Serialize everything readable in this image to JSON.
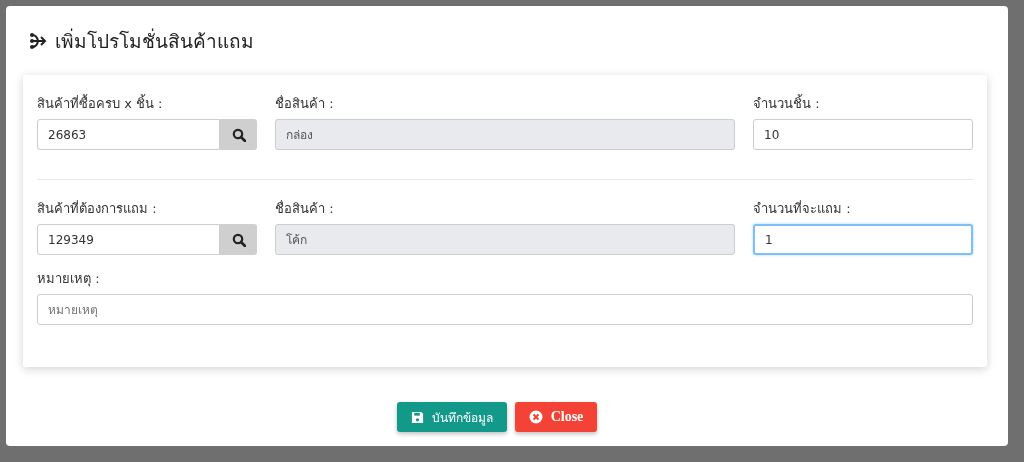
{
  "dialog": {
    "title": "เพิ่มโปรโมชั่นสินค้าแถม"
  },
  "sections": [
    {
      "fields": [
        {
          "kind": "lookup",
          "label": "สินค้าที่ซื้อครบ x ชิ้น :",
          "value": "26863",
          "focused": false
        },
        {
          "kind": "readonly",
          "label": "ชื่อสินค้า :",
          "value": "กล่อง",
          "focused": false
        },
        {
          "kind": "text",
          "label": "จำนวนชิ้น :",
          "value": "10",
          "focused": false
        }
      ]
    },
    {
      "fields": [
        {
          "kind": "lookup",
          "label": "สินค้าที่ต้องการแถม :",
          "value": "129349",
          "focused": false
        },
        {
          "kind": "readonly",
          "label": "ชื่อสินค้า :",
          "value": "โค้ก",
          "focused": false
        },
        {
          "kind": "text",
          "label": "จำนวนที่จะแถม :",
          "value": "1",
          "focused": true
        }
      ]
    }
  ],
  "note": {
    "label": "หมายเหตุ :",
    "placeholder": "หมายเหตุ"
  },
  "buttons": [
    {
      "kind": "save",
      "label": "บันทึกข้อมูล"
    },
    {
      "kind": "close",
      "label": "Close"
    }
  ]
}
